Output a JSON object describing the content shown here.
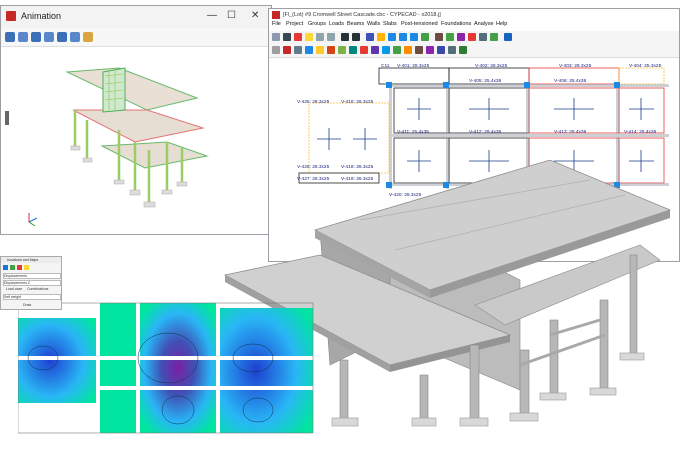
{
  "animation_window": {
    "title": "Animation",
    "controls": {
      "minimize": "—",
      "maximize": "☐",
      "close": "✕"
    },
    "toolbar_icons": [
      "rotate-icon",
      "pan-icon",
      "zoom-window-icon",
      "zoom-extents-icon",
      "refresh-icon",
      "zoom-out-icon",
      "hand-icon"
    ]
  },
  "cad_window": {
    "title": "[Fl_(Lot) #9 Cromwell Street Cascade.cbc - CYPECAD - x2018.j]",
    "menu": [
      "File",
      "Project",
      "Groups",
      "Loads",
      "Beams",
      "Walls",
      "Slabs",
      "Post-tensioned",
      "Foundations",
      "Analyse",
      "Help"
    ],
    "plan_labels": {
      "column_c11": "C11",
      "column_c9": "C9",
      "beam_v401": "V-401: 28.3x25",
      "beam_v402": "V-402: 28.3x25",
      "beam_v403": "V-403: 28.3x25",
      "beam_v404": "V-404: 25.3x25",
      "beam_v405": "V-405: 25.4x36",
      "beam_v406": "V-406: 25.4x36",
      "beam_v411": "V-411: 25.4x36",
      "beam_v412": "V-412: 29.4x36",
      "beam_v413": "V-413: 25.4x36",
      "beam_v414": "V-414: 25.4x36",
      "beam_v416": "V-416: 28.3x25",
      "beam_v418": "V-418: 28.3x25",
      "beam_v419": "V-419: 28.3x25",
      "beam_v420": "V-420: 28.3x25",
      "beam_v425": "V-425: 28.3x25",
      "beam_v426": "V-426: 28.3x25",
      "beam_v427": "V-427: 28.3x25"
    }
  },
  "dialog": {
    "title": "Isovalues and Maps",
    "row1": "Displacements",
    "row2": "Displacements Z",
    "radio1": "Load case",
    "radio2": "Combinations",
    "row3": "Self weight",
    "button": "Draw"
  }
}
